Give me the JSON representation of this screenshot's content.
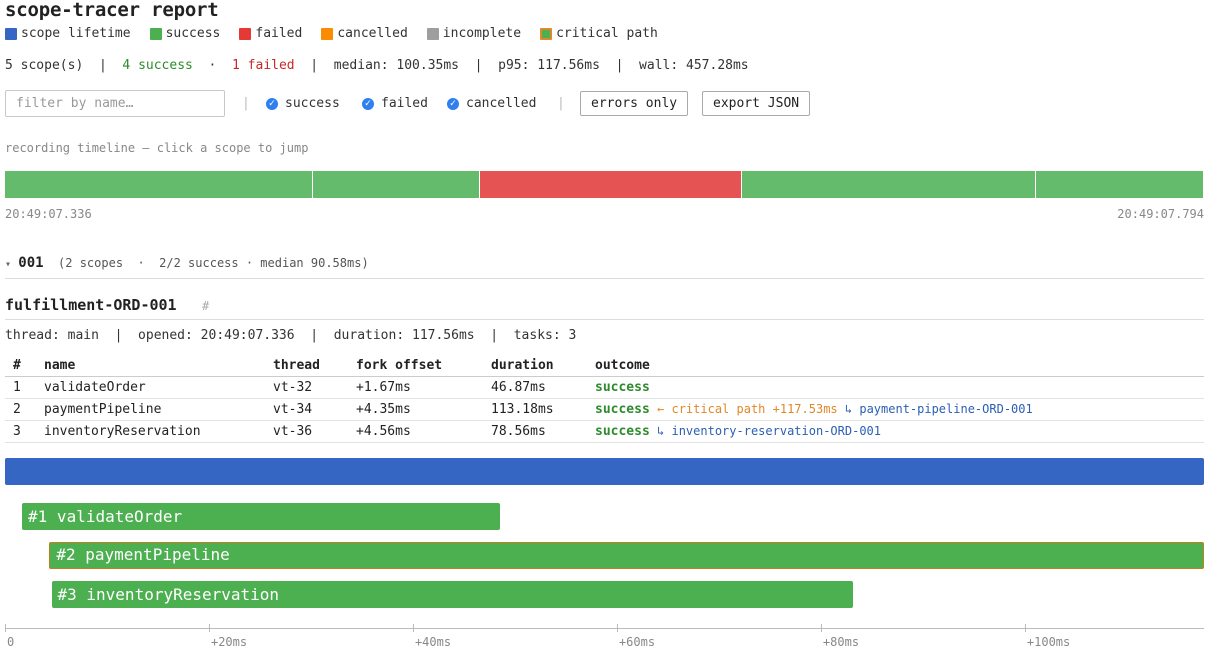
{
  "title": "scope-tracer report",
  "legend": [
    {
      "label": "scope lifetime",
      "color": "#3566c3"
    },
    {
      "label": "success",
      "color": "#4caf50"
    },
    {
      "label": "failed",
      "color": "#e53935"
    },
    {
      "label": "cancelled",
      "color": "#fb8c00"
    },
    {
      "label": "incomplete",
      "color": "#9e9e9e"
    },
    {
      "label": "critical path",
      "color": "#4caf50",
      "border": "#e0892a"
    }
  ],
  "summary": {
    "scopes": "5 scope(s)",
    "success": "4 success",
    "dot": "·",
    "failed": "1 failed",
    "median": "median: 100.35ms",
    "p95": "p95: 117.56ms",
    "wall": "wall: 457.28ms",
    "sep": "|"
  },
  "controls": {
    "filter_placeholder": "filter by name…",
    "sep": "|",
    "check_success": "success",
    "check_failed": "failed",
    "check_cancelled": "cancelled",
    "errors_only": "errors only",
    "export_json": "export JSON"
  },
  "recording": {
    "caption": "recording timeline — click a scope to jump",
    "start": "20:49:07.336",
    "end": "20:49:07.794",
    "segments": [
      {
        "status": "success",
        "color": "#63bb6b",
        "fraction": 0.257
      },
      {
        "status": "success",
        "color": "#63bb6b",
        "fraction": 0.139
      },
      {
        "status": "failed",
        "color": "#e55353",
        "fraction": 0.219
      },
      {
        "status": "success",
        "color": "#63bb6b",
        "fraction": 0.245
      },
      {
        "status": "success",
        "color": "#63bb6b",
        "fraction": 0.14
      }
    ]
  },
  "group": {
    "toggle": "▾",
    "name": "001",
    "details": "(2 scopes  ·  2/2 success · median 90.58ms)"
  },
  "scope": {
    "name": "fulfillment-ORD-001",
    "hash": "#",
    "meta": "thread: main  |  opened: 20:49:07.336  |  duration: 117.56ms  |  tasks: 3",
    "columns": [
      "#",
      "name",
      "thread",
      "fork offset",
      "duration",
      "outcome"
    ],
    "tasks": [
      {
        "n": "1",
        "name": "validateOrder",
        "thread": "vt-32",
        "fork": "+1.67ms",
        "duration": "46.87ms",
        "outcome": "success",
        "critical": "",
        "link": ""
      },
      {
        "n": "2",
        "name": "paymentPipeline",
        "thread": "vt-34",
        "fork": "+4.35ms",
        "duration": "113.18ms",
        "outcome": "success",
        "critical": "← critical path +117.53ms",
        "link": "↳ payment-pipeline-ORD-001"
      },
      {
        "n": "3",
        "name": "inventoryReservation",
        "thread": "vt-36",
        "fork": "+4.56ms",
        "duration": "78.56ms",
        "outcome": "success",
        "critical": "",
        "link": "↳ inventory-reservation-ORD-001"
      }
    ]
  },
  "gantt": {
    "total_ms": 117.56,
    "bars": [
      {
        "label": "#1 validateOrder",
        "start_ms": 1.67,
        "duration_ms": 46.87,
        "critical": false
      },
      {
        "label": "#2 paymentPipeline",
        "start_ms": 4.35,
        "duration_ms": 113.18,
        "critical": true
      },
      {
        "label": "#3 inventoryReservation",
        "start_ms": 4.56,
        "duration_ms": 78.56,
        "critical": false
      }
    ],
    "ticks": [
      {
        "ms": 0,
        "label": "0"
      },
      {
        "ms": 20,
        "label": "+20ms"
      },
      {
        "ms": 40,
        "label": "+40ms"
      },
      {
        "ms": 60,
        "label": "+60ms"
      },
      {
        "ms": 80,
        "label": "+80ms"
      },
      {
        "ms": 100,
        "label": "+100ms"
      }
    ]
  }
}
